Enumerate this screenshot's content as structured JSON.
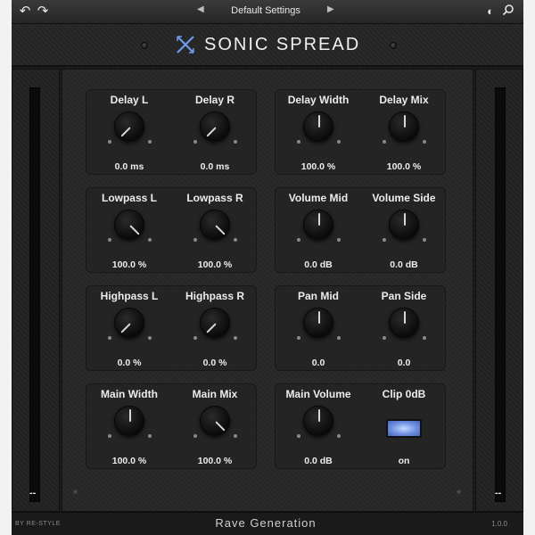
{
  "toolbar": {
    "undo_icon": "undo-icon",
    "redo_icon": "redo-icon",
    "preset_name": "Default Settings",
    "prev_icon": "triangle-left-icon",
    "next_icon": "triangle-right-icon",
    "contrast_icon": "contrast-icon",
    "search_icon": "search-icon"
  },
  "header": {
    "title": "SONIC SPREAD",
    "logo": "x-logo-icon",
    "logo_color": "#6f9be8"
  },
  "meters": {
    "left_value": "--",
    "right_value": "--"
  },
  "groups": [
    {
      "controls": [
        {
          "label": "Delay L",
          "value": "0.0 ms",
          "knob_angle": -135
        },
        {
          "label": "Delay R",
          "value": "0.0 ms",
          "knob_angle": -135
        }
      ]
    },
    {
      "controls": [
        {
          "label": "Delay Width",
          "value": "100.0 %",
          "knob_angle": 0
        },
        {
          "label": "Delay Mix",
          "value": "100.0 %",
          "knob_angle": 0
        }
      ]
    },
    {
      "controls": [
        {
          "label": "Lowpass L",
          "value": "100.0 %",
          "knob_angle": 135
        },
        {
          "label": "Lowpass R",
          "value": "100.0 %",
          "knob_angle": 135
        }
      ]
    },
    {
      "controls": [
        {
          "label": "Volume Mid",
          "value": "0.0 dB",
          "knob_angle": 0
        },
        {
          "label": "Volume Side",
          "value": "0.0 dB",
          "knob_angle": 0
        }
      ]
    },
    {
      "controls": [
        {
          "label": "Highpass L",
          "value": "0.0 %",
          "knob_angle": -135
        },
        {
          "label": "Highpass R",
          "value": "0.0 %",
          "knob_angle": -135
        }
      ]
    },
    {
      "controls": [
        {
          "label": "Pan Mid",
          "value": "0.0",
          "knob_angle": 0
        },
        {
          "label": "Pan Side",
          "value": "0.0",
          "knob_angle": 0
        }
      ]
    },
    {
      "controls": [
        {
          "label": "Main Width",
          "value": "100.0 %",
          "knob_angle": 0
        },
        {
          "label": "Main Mix",
          "value": "100.0 %",
          "knob_angle": 135
        }
      ]
    },
    {
      "controls": [
        {
          "label": "Main Volume",
          "value": "0.0 dB",
          "knob_angle": 0
        },
        {
          "label": "Clip 0dB",
          "value": "on",
          "toggle_color": "#8fb0f5"
        }
      ]
    }
  ],
  "footer": {
    "by": "BY RE-STYLE",
    "brand": "Rave Generation",
    "version": "1.0.0"
  }
}
